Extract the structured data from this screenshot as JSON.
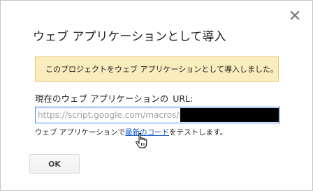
{
  "dialog": {
    "title": "ウェブ アプリケーションとして導入",
    "close_icon": "close-icon",
    "notice": "このプロジェクトをウェブ アプリケーションとして導入しました。",
    "url_label_prefix": "現在のウェブ アプリケーションの",
    "url_label_suffix": "URL:",
    "url_value": "https://script.google.com/macros/s/",
    "test_prefix": "ウェブ アプリケーションで",
    "test_link": "最新のコード",
    "test_suffix": "をテストします。",
    "ok_label": "OK"
  },
  "colors": {
    "notice_bg": "#f9edbe",
    "notice_border": "#f0c36d",
    "link": "#1155cc",
    "input_focus_border": "#4d90fe"
  }
}
